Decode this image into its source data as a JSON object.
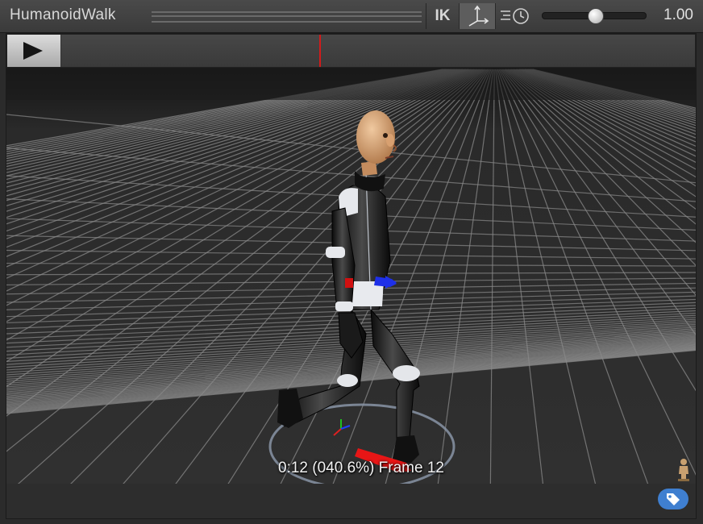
{
  "toolbar": {
    "clip_name": "HumanoidWalk",
    "ik_label": "IK",
    "pivot_icon": "pivot-axes-icon",
    "speed_icon": "playback-speed-icon",
    "speed_value": "1.00",
    "speed_slider_fraction": 0.5
  },
  "timeline": {
    "play_icon": "play-icon",
    "playhead_fraction": 0.407
  },
  "viewport": {
    "frame_label": "0:12 (040.6%) Frame 12",
    "avatar_icon": "avatar-icon"
  },
  "bottom_bar": {
    "label_icon": "tag-icon"
  },
  "colors": {
    "playhead": "#d21b1b",
    "label_button": "#3f7fd0",
    "grid_line": "#8a8a8a",
    "axis_x": "#e02020",
    "axis_y": "#20c020",
    "axis_z": "#2040ff"
  }
}
